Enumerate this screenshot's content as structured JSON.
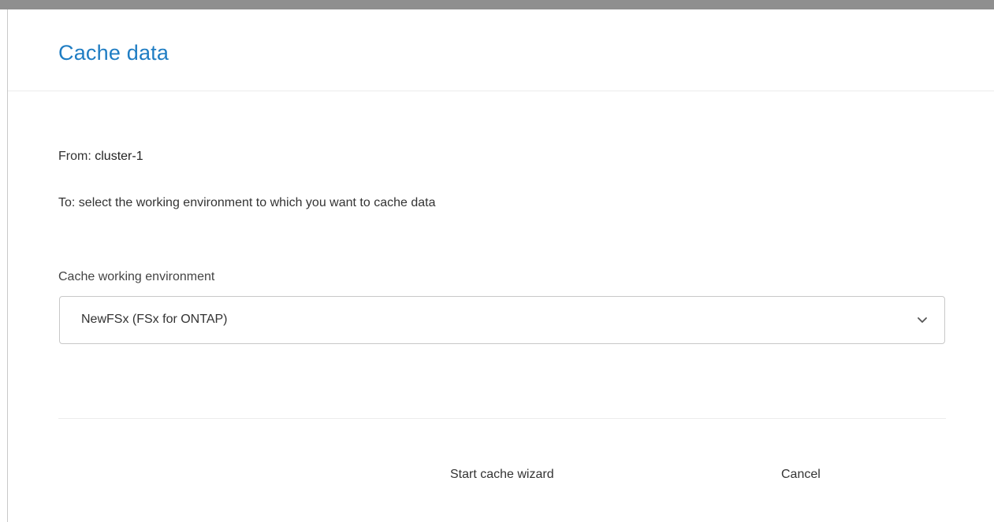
{
  "dialog": {
    "title": "Cache data",
    "from_label": "From:",
    "from_value": "cluster-1",
    "to_text": "To: select the working environment to which you want to cache data",
    "field_label": "Cache working environment",
    "selected_environment": "NewFSx (FSx for ONTAP)",
    "start_button": "Start cache wizard",
    "cancel_button": "Cancel"
  },
  "icons": {
    "dropdown": "chevron-down-icon"
  },
  "colors": {
    "title": "#1f7dc3"
  }
}
